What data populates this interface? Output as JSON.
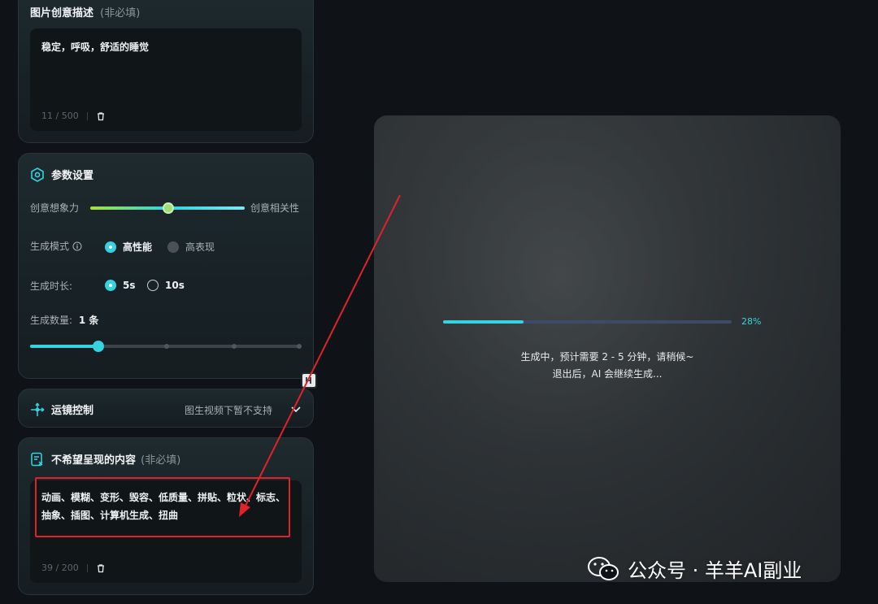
{
  "prompt_panel": {
    "title": "图片创意描述",
    "optional_note": "(非必填)",
    "text": "稳定，呼吸，舒适的睡觉",
    "counter": "11 / 500"
  },
  "params_panel": {
    "title": "参数设置",
    "slider_left_label": "创意想象力",
    "slider_right_label": "创意相关性",
    "creativity_value": 0.5,
    "mode_label": "生成模式",
    "mode_options": [
      "高性能",
      "高表现"
    ],
    "mode_selected": "高性能",
    "duration_label": "生成时长:",
    "duration_options": [
      "5s",
      "10s"
    ],
    "duration_selected": "5s",
    "count_label": "生成数量:",
    "count_value": "1 条",
    "count_slider_value": 0.25
  },
  "camera_panel": {
    "title": "运镜控制",
    "note": "图生视频下暂不支持"
  },
  "negative_panel": {
    "title": "不希望呈现的内容",
    "optional_note": "(非必填)",
    "text": "动画、模糊、变形、毁容、低质量、拼贴、粒状、标志、抽象、插图、计算机生成、扭曲",
    "counter": "39 / 200"
  },
  "preview": {
    "progress_percent": 28,
    "progress_label": "28%",
    "status_line1": "生成中，预计需要 2 - 5 分钟，请稍候~",
    "status_line2": "退出后，AI 会继续生成..."
  },
  "watermark": {
    "text": "公众号 · 羊羊AI副业"
  },
  "colors": {
    "accent": "#35d2df",
    "annotation_red": "#e0232a",
    "slider_green": "#a6e13a"
  }
}
